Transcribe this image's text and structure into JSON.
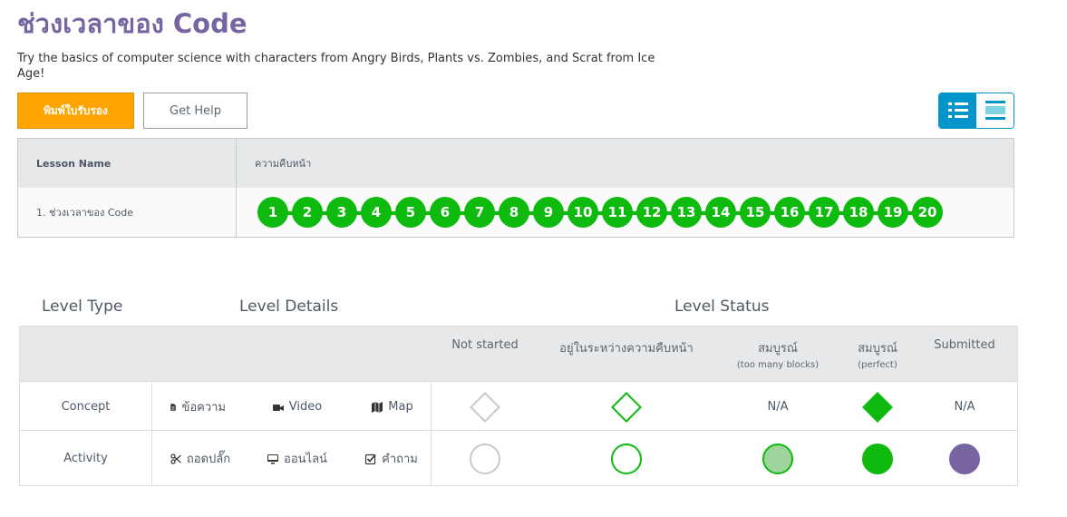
{
  "page": {
    "title": "ช่วงเวลาของ Code",
    "description": "Try the basics of computer science with characters from Angry Birds, Plants vs. Zombies, and Scrat from Ice Age!",
    "print_button": "พิมพ์ใบรับรอง",
    "help_button": "Get Help"
  },
  "view_toggle": {
    "detail_icon": "list-detail-icon",
    "summary_icon": "list-summary-icon",
    "active": "detail"
  },
  "progress_table": {
    "col_lesson": "Lesson Name",
    "col_progress": "ความคืบหน้า",
    "lesson_name": "1. ช่วงเวลาของ Code",
    "levels": [
      "1",
      "2",
      "3",
      "4",
      "5",
      "6",
      "7",
      "8",
      "9",
      "10",
      "11",
      "12",
      "13",
      "14",
      "15",
      "16",
      "17",
      "18",
      "19",
      "20"
    ],
    "level_status": "perfect"
  },
  "key": {
    "header_type": "Level Type",
    "header_details": "Level Details",
    "header_status": "Level Status",
    "status_cols": [
      {
        "label": "Not started",
        "sub": ""
      },
      {
        "label": "อยู่ในระหว่างความคืบหน้า",
        "sub": ""
      },
      {
        "label": "สมบูรณ์",
        "sub": "(too many blocks)"
      },
      {
        "label": "สมบูรณ์",
        "sub": "(perfect)"
      },
      {
        "label": "Submitted",
        "sub": ""
      }
    ],
    "concept": {
      "label": "Concept",
      "details": [
        {
          "icon": "document-icon",
          "label": "ข้อความ"
        },
        {
          "icon": "video-icon",
          "label": "Video"
        },
        {
          "icon": "map-icon",
          "label": "Map"
        }
      ],
      "na": "N/A"
    },
    "activity": {
      "label": "Activity",
      "details": [
        {
          "icon": "scissors-icon",
          "label": "ถอดปลั๊ก"
        },
        {
          "icon": "desktop-icon",
          "label": "ออนไลน์"
        },
        {
          "icon": "checkbox-icon",
          "label": "คำถาม"
        }
      ]
    }
  },
  "colors": {
    "title": "#7665a0",
    "print_button": "#ffa400",
    "toggle_active": "#0094ca",
    "perfect": "#0eba0e",
    "too_many_blocks": "#9fd49f",
    "not_started": "#c6cacd",
    "submitted": "#7665a0"
  }
}
